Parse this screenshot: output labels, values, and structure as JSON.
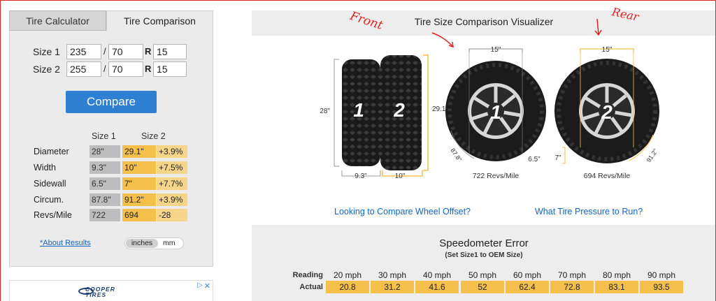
{
  "tabs": {
    "calculator": "Tire Calculator",
    "comparison": "Tire Comparison"
  },
  "sizes": [
    {
      "label": "Size 1",
      "width": "235",
      "sep": "/",
      "aspect": "70",
      "r": "R",
      "rim": "15"
    },
    {
      "label": "Size 2",
      "width": "255",
      "sep": "/",
      "aspect": "70",
      "r": "R",
      "rim": "15"
    }
  ],
  "compare_label": "Compare",
  "results": {
    "head1": "Size 1",
    "head2": "Size 2",
    "rows": [
      {
        "label": "Diameter",
        "s1": "28\"",
        "s2": "29.1\"",
        "diff": "+3.9%"
      },
      {
        "label": "Width",
        "s1": "9.3\"",
        "s2": "10\"",
        "diff": "+7.5%"
      },
      {
        "label": "Sidewall",
        "s1": "6.5\"",
        "s2": "7\"",
        "diff": "+7.7%"
      },
      {
        "label": "Circum.",
        "s1": "87.8\"",
        "s2": "91.2\"",
        "diff": "+3.9%"
      },
      {
        "label": "Revs/Mile",
        "s1": "722",
        "s2": "694",
        "diff": "-28"
      }
    ]
  },
  "about_link": "*About Results",
  "units": {
    "inches": "inches",
    "mm": "mm"
  },
  "ad": {
    "brand": "COOPER",
    "brand2": "TIRES",
    "adchoice": "▷",
    "close": "✕"
  },
  "visualizer": {
    "title": "Tire Size Comparison Visualizer",
    "front_note": "Front",
    "rear_note": "Rear",
    "side_height_1": "28\"",
    "side_height_2": "29.1\"",
    "tread_width_1": "9.3\"",
    "tread_width_2": "10\"",
    "tire_num_1": "1",
    "tire_num_2": "2",
    "wheel1": {
      "rim": "15\"",
      "circ": "87.8\"",
      "sidewall": "6.5\"",
      "revs": "722 Revs/Mile",
      "num": "1"
    },
    "wheel2": {
      "rim": "15\"",
      "circ": "91.2\"",
      "sidewall": "7\"",
      "revs": "694 Revs/Mile",
      "num": "2"
    }
  },
  "links": {
    "offset": "Looking to Compare Wheel Offset?",
    "pressure": "What Tire Pressure to Run?"
  },
  "speedometer": {
    "title": "Speedometer Error",
    "subtitle": "(Set Size1 to OEM Size)",
    "reading_label": "Reading",
    "actual_label": "Actual",
    "readings": [
      "20 mph",
      "30 mph",
      "40 mph",
      "50 mph",
      "60 mph",
      "70 mph",
      "80 mph",
      "90 mph"
    ],
    "actuals": [
      "20.8",
      "31.2",
      "41.6",
      "52",
      "62.4",
      "72.8",
      "83.1",
      "93.5"
    ]
  },
  "colors": {
    "accent": "#2f80d3",
    "highlight": "#f4bf4b",
    "annotation": "#e02424"
  }
}
